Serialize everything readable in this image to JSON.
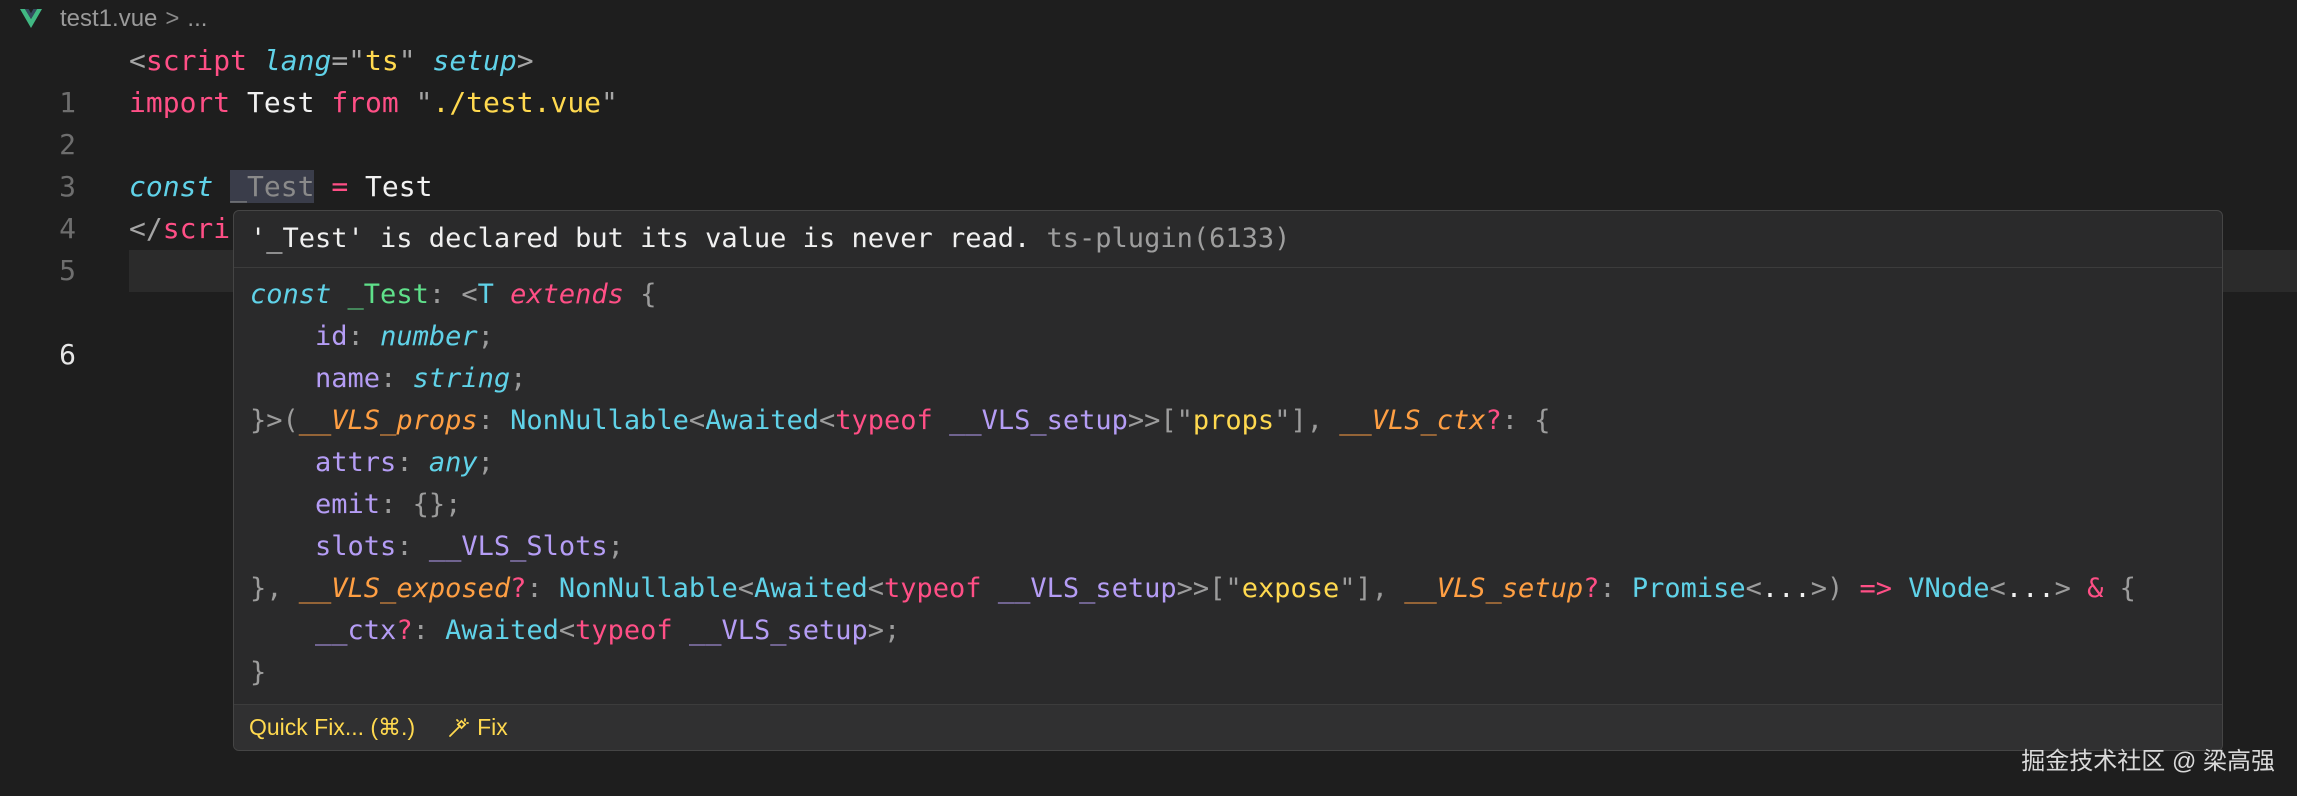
{
  "breadcrumb": {
    "icon": "vue-logo-icon",
    "file": "test1.vue",
    "separator": ">",
    "more": "..."
  },
  "editor": {
    "lines": [
      {
        "number": "1",
        "tokens": [
          "<",
          "script",
          "lang",
          "=\"",
          "ts",
          "\"",
          "setup",
          ">"
        ]
      },
      {
        "number": "2",
        "tokens": [
          "import",
          "Test",
          "from",
          "\"",
          "./test.vue",
          "\""
        ]
      },
      {
        "number": "3",
        "tokens": []
      },
      {
        "number": "4",
        "tokens": [
          "const",
          "_Test",
          "=",
          "Test"
        ]
      },
      {
        "number": "5",
        "tokens": [
          "</",
          "scri"
        ]
      },
      {
        "number": "6",
        "tokens": []
      }
    ]
  },
  "hover": {
    "message": "'_Test' is declared but its value is never read.",
    "source": "ts-plugin(6133)",
    "signature": [
      "const _Test: <T extends {",
      "    id: number;",
      "    name: string;",
      "}>(__VLS_props: NonNullable<Awaited<typeof __VLS_setup>>[\"props\"], __VLS_ctx?: {",
      "    attrs: any;",
      "    emit: {};",
      "    slots: __VLS_Slots;",
      "}, __VLS_exposed?: NonNullable<Awaited<typeof __VLS_setup>>[\"expose\"], __VLS_setup?: Promise<...>) => VNode<...> & {",
      "    __ctx?: Awaited<typeof __VLS_setup>;",
      "}"
    ],
    "actions": {
      "quick_fix": "Quick Fix... (⌘.)",
      "fix": "Fix",
      "fix_icon": "magic-wand-icon"
    }
  },
  "watermark": "掘金技术社区 @ 梁高强",
  "colors": {
    "background": "#1e1e1e",
    "keyword": "#ff4f86",
    "string": "#ffd94f",
    "type": "#60d2e8",
    "variable": "#5fe08a",
    "property": "#b59df5",
    "parameter": "#ff9f43"
  }
}
